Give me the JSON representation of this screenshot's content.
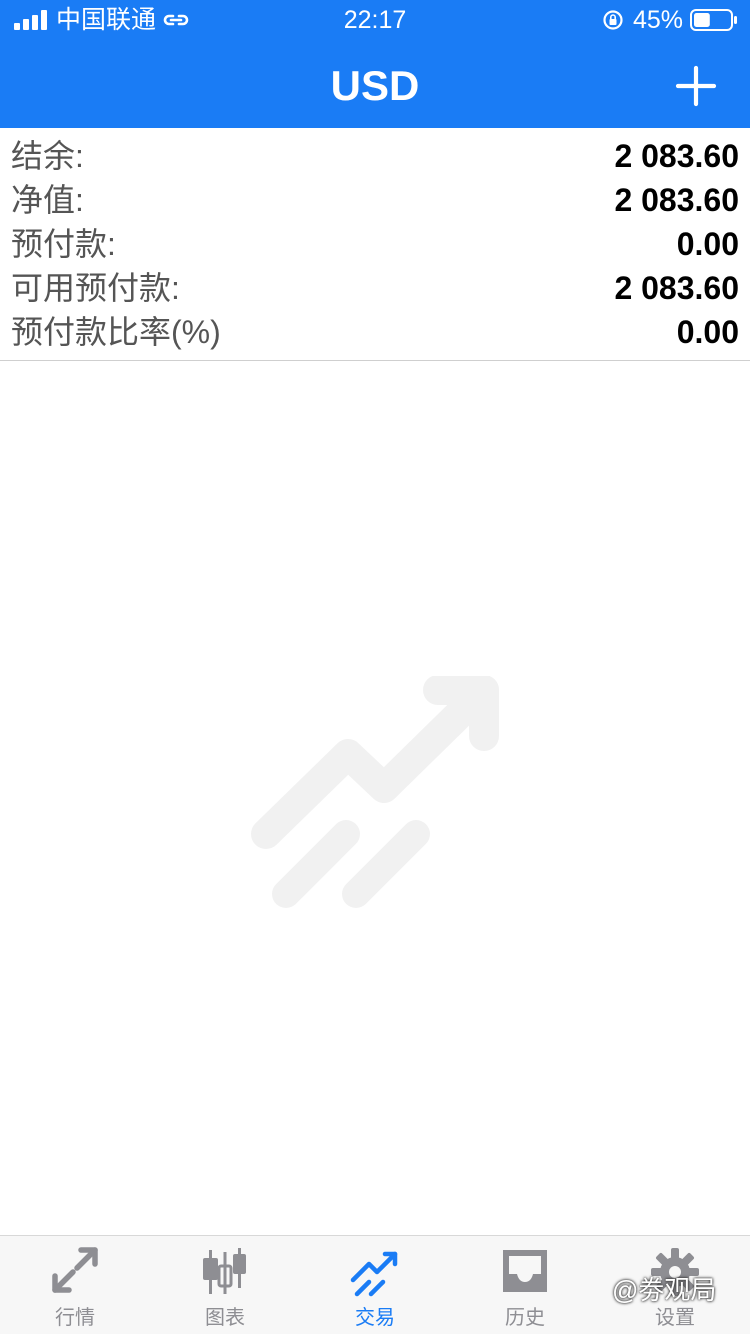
{
  "status_bar": {
    "carrier": "中国联通",
    "time": "22:17",
    "battery_percent": "45%",
    "battery_level": 0.45,
    "icons": [
      "signal-icon",
      "link-icon",
      "orientation-lock-icon",
      "battery-icon"
    ]
  },
  "nav": {
    "title": "USD",
    "add_icon": "plus-icon"
  },
  "summary": {
    "rows": [
      {
        "label": "结余:",
        "value": "2 083.60"
      },
      {
        "label": "净值:",
        "value": "2 083.60"
      },
      {
        "label": "预付款:",
        "value": "0.00"
      },
      {
        "label": "可用预付款:",
        "value": "2 083.60"
      },
      {
        "label": "预付款比率(%)",
        "value": "0.00"
      }
    ]
  },
  "empty_state": {
    "icon": "trade-arrow-icon"
  },
  "tabs": [
    {
      "label": "行情",
      "icon": "quotes-icon",
      "active": false
    },
    {
      "label": "图表",
      "icon": "candlestick-chart-icon",
      "active": false
    },
    {
      "label": "交易",
      "icon": "trade-icon",
      "active": true
    },
    {
      "label": "历史",
      "icon": "history-inbox-icon",
      "active": false
    },
    {
      "label": "设置",
      "icon": "gear-icon",
      "active": false
    }
  ],
  "watermark": {
    "text": "@劵观局"
  },
  "colors": {
    "accent": "#1a7cf5",
    "tab_inactive": "#8e8e93",
    "label_text": "#555555",
    "value_text": "#000000"
  }
}
